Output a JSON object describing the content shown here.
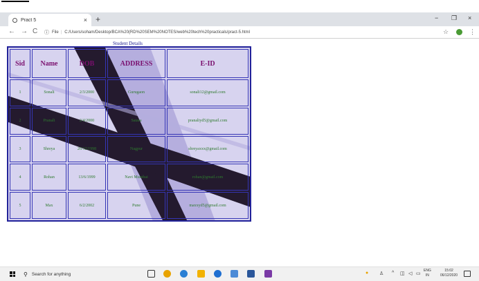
{
  "browser": {
    "tab_title": "Pract 5",
    "tab_close": "×",
    "new_tab": "+",
    "minimize": "−",
    "restore": "❐",
    "close": "×",
    "back": "←",
    "forward": "→",
    "reload": "C",
    "info": "ⓘ",
    "address_prefix": "File",
    "address_sep": "|",
    "url": "C:/Users/soham/Desktop/BCA%20(RD%20SEM%20NOTES/web%20tech%20practicals/pract-5.html",
    "star": "☆",
    "menu": "⋮"
  },
  "page": {
    "caption": "Student Details",
    "headers": [
      "Sid",
      "Name",
      "DOB",
      "ADDRESS",
      "E-ID"
    ],
    "rows": [
      [
        "1",
        "Sonali",
        "2/3/2000",
        "Gurugaon",
        "sonali12@gmail.com"
      ],
      [
        "2",
        "Pranali",
        "2/4/2000",
        "Satara",
        "pranaliyd5@gmail.com"
      ],
      [
        "3",
        "Shreya",
        "26/12/1998",
        "Nagpur",
        "shreyaxxx@gmail.com"
      ],
      [
        "4",
        "Rohan",
        "13/6/1999",
        "Navi Mumbai",
        "rohan@gmail.com"
      ],
      [
        "5",
        "Max",
        "6/2/2002",
        "Pune",
        "maxxyd5@gmail.com"
      ]
    ]
  },
  "taskbar": {
    "search_placeholder": "Search for anything",
    "lang_line1": "ENG",
    "lang_line2": "IN",
    "time": "15:02",
    "date": "06/12/2020",
    "tray_chevron": "^",
    "app_colors": [
      "#333333",
      "#e8a300",
      "#2a7fd4",
      "#f2b200",
      "#1f6fd1",
      "#4b8ad6",
      "#2b579a",
      "#7a3aa5"
    ]
  },
  "colors": {
    "header_text": "#7a0f6e",
    "cell_text": "#2e7a2e",
    "border": "#22229a"
  }
}
